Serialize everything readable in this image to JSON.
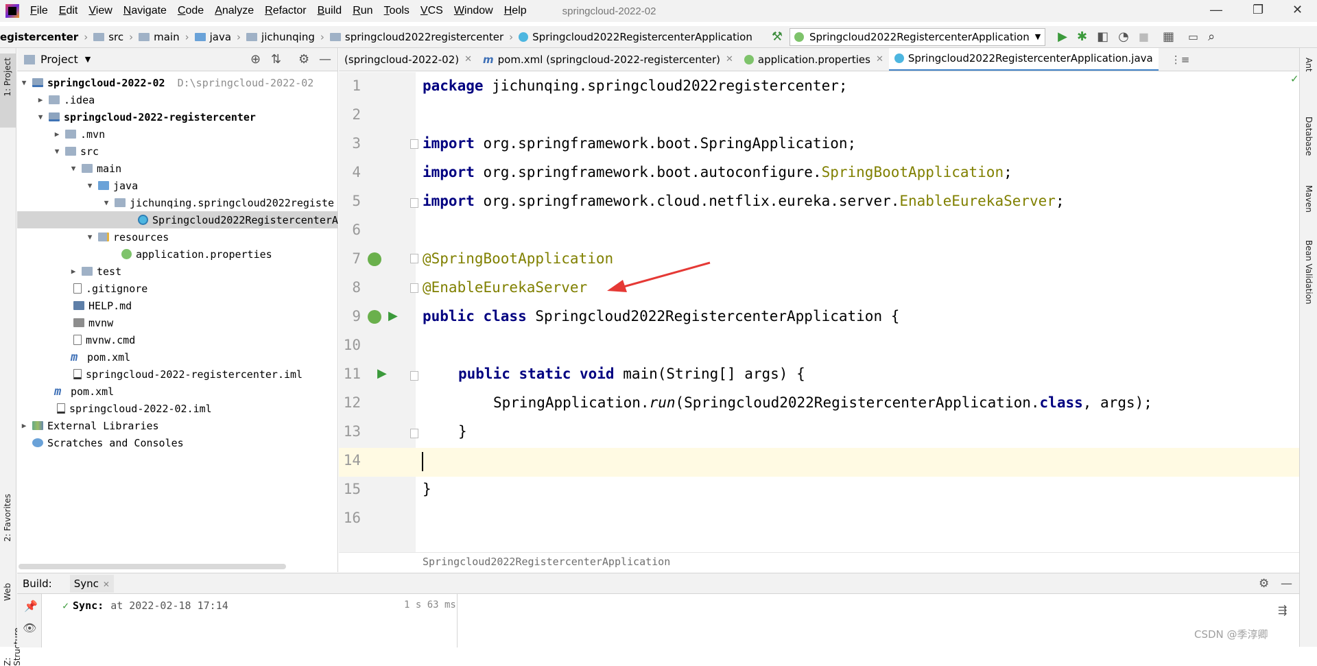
{
  "menu": [
    "File",
    "Edit",
    "View",
    "Navigate",
    "Code",
    "Analyze",
    "Refactor",
    "Build",
    "Run",
    "Tools",
    "VCS",
    "Window",
    "Help"
  ],
  "window_title": "springcloud-2022-02",
  "breadcrumbs": [
    "egistercenter",
    "src",
    "main",
    "java",
    "jichunqing",
    "springcloud2022registercenter",
    "Springcloud2022RegistercenterApplication"
  ],
  "run_config": "Springcloud2022RegistercenterApplication",
  "left_tools": {
    "project": "1: Project",
    "favorites": "2: Favorites",
    "web": "Web",
    "structure": "Z: Structure"
  },
  "right_tools": {
    "ant": "Ant",
    "database": "Database",
    "maven": "Maven",
    "bean": "Bean Validation"
  },
  "project_panel": {
    "title": "Project",
    "tree": [
      {
        "label": "springcloud-2022-02",
        "extra": "D:\\springcloud-2022-02",
        "bold": true
      },
      {
        "label": ".idea"
      },
      {
        "label": "springcloud-2022-registercenter",
        "bold": true
      },
      {
        "label": ".mvn"
      },
      {
        "label": "src"
      },
      {
        "label": "main"
      },
      {
        "label": "java"
      },
      {
        "label": "jichunqing.springcloud2022registe"
      },
      {
        "label": "Springcloud2022RegistercenterA"
      },
      {
        "label": "resources"
      },
      {
        "label": "application.properties"
      },
      {
        "label": "test"
      },
      {
        "label": ".gitignore"
      },
      {
        "label": "HELP.md"
      },
      {
        "label": "mvnw"
      },
      {
        "label": "mvnw.cmd"
      },
      {
        "label": "pom.xml"
      },
      {
        "label": "springcloud-2022-registercenter.iml"
      },
      {
        "label": "pom.xml"
      },
      {
        "label": "springcloud-2022-02.iml"
      },
      {
        "label": "External Libraries"
      },
      {
        "label": "Scratches and Consoles"
      }
    ]
  },
  "tabs": [
    {
      "label": "(springcloud-2022-02)"
    },
    {
      "label": "pom.xml (springcloud-2022-registercenter)"
    },
    {
      "label": "application.properties"
    },
    {
      "label": "Springcloud2022RegistercenterApplication.java",
      "active": true
    }
  ],
  "line_numbers": [
    "1",
    "2",
    "3",
    "4",
    "5",
    "6",
    "7",
    "8",
    "9",
    "10",
    "11",
    "12",
    "13",
    "14",
    "15",
    "16"
  ],
  "code": {
    "l1_kw": "package",
    "l1_rest": " jichunqing.springcloud2022registercenter;",
    "l3_kw": "import",
    "l3_rest": " org.springframework.boot.SpringApplication;",
    "l4_kw": "import",
    "l4_rest": " org.springframework.boot.autoconfigure.",
    "l4_ann": "SpringBootApplication",
    "l4_end": ";",
    "l5_kw": "import",
    "l5_rest": " org.springframework.cloud.netflix.eureka.server.",
    "l5_ann": "EnableEurekaServer",
    "l5_end": ";",
    "l7": "@SpringBootApplication",
    "l8": "@EnableEurekaServer",
    "l9_kw": "public class",
    "l9_rest": " Springcloud2022RegistercenterApplication {",
    "l11_kw": "public static void",
    "l11_rest": " main(String[] args) {",
    "l12_a": "SpringApplication.",
    "l12_it": "run",
    "l12_b": "(Springcloud2022RegistercenterApplication.",
    "l12_kw": "class",
    "l12_c": ", args);",
    "l13": "}",
    "l15": "}"
  },
  "editor_breadcrumb": "Springcloud2022RegistercenterApplication",
  "build": {
    "label": "Build:",
    "tab": "Sync",
    "sync_label": "Sync:",
    "sync_text": "at 2022-02-18 17:14",
    "duration": "1 s 63 ms"
  },
  "watermark": "CSDN @季淳卿",
  "colors": {
    "keyword": "#000080",
    "annotation": "#808000",
    "arrow": "#e53935",
    "active_tab": "#4083c9"
  }
}
